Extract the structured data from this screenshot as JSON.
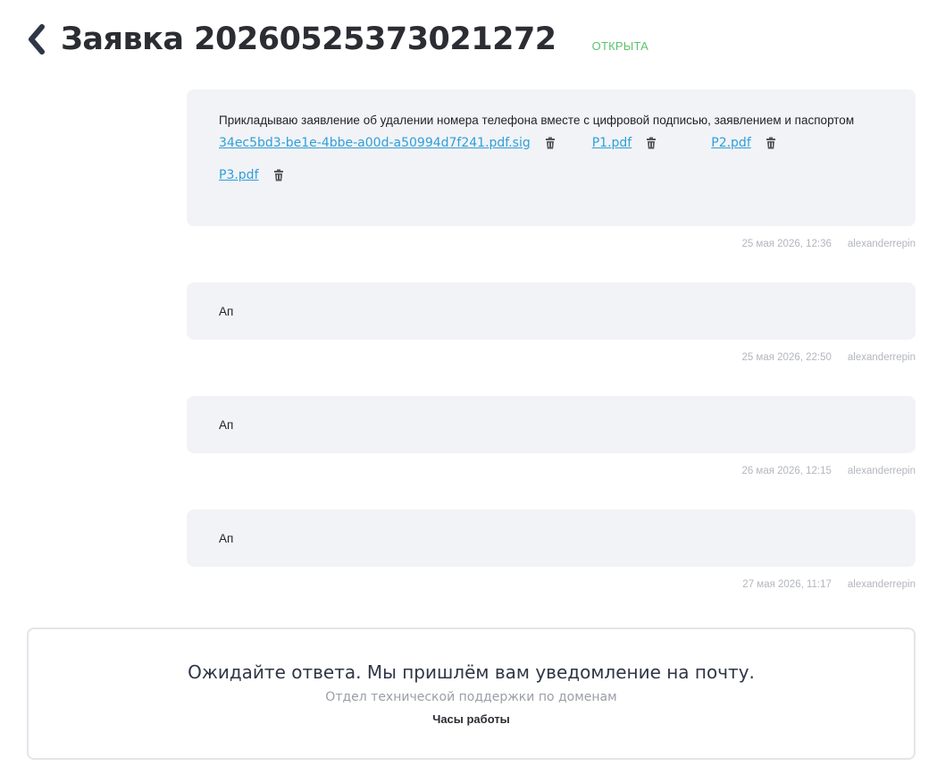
{
  "header": {
    "title": "Заявка 20260525373021272",
    "status": "ОТКРЫТА"
  },
  "messages": [
    {
      "text": "Прикладываю заявление об удалении номера телефона вместе с цифровой подписью, заявлением и паспортом",
      "attachments": [
        "34ec5bd3-be1e-4bbe-a00d-a50994d7f241.pdf.sig",
        "P1.pdf",
        "P2.pdf",
        "P3.pdf"
      ],
      "date": "25 мая 2026, 12:36",
      "author": "alexanderrepin"
    },
    {
      "text": "Ап",
      "date": "25 мая 2026, 22:50",
      "author": "alexanderrepin"
    },
    {
      "text": "Ап",
      "date": "26 мая 2026, 12:15",
      "author": "alexanderrepin"
    },
    {
      "text": "Ап",
      "date": "27 мая 2026, 11:17",
      "author": "alexanderrepin"
    }
  ],
  "info": {
    "main": "Ожидайте ответа. Мы пришлём вам уведомление на почту.",
    "sub": "Отдел технической поддержки по доменам",
    "hours": "Часы работы"
  },
  "colors": {
    "status": "#5cc36b",
    "link": "#2f9fd8",
    "bubble": "#f2f3f7"
  },
  "icons": {
    "back": "chevron-left-icon",
    "delete": "trash-icon"
  }
}
